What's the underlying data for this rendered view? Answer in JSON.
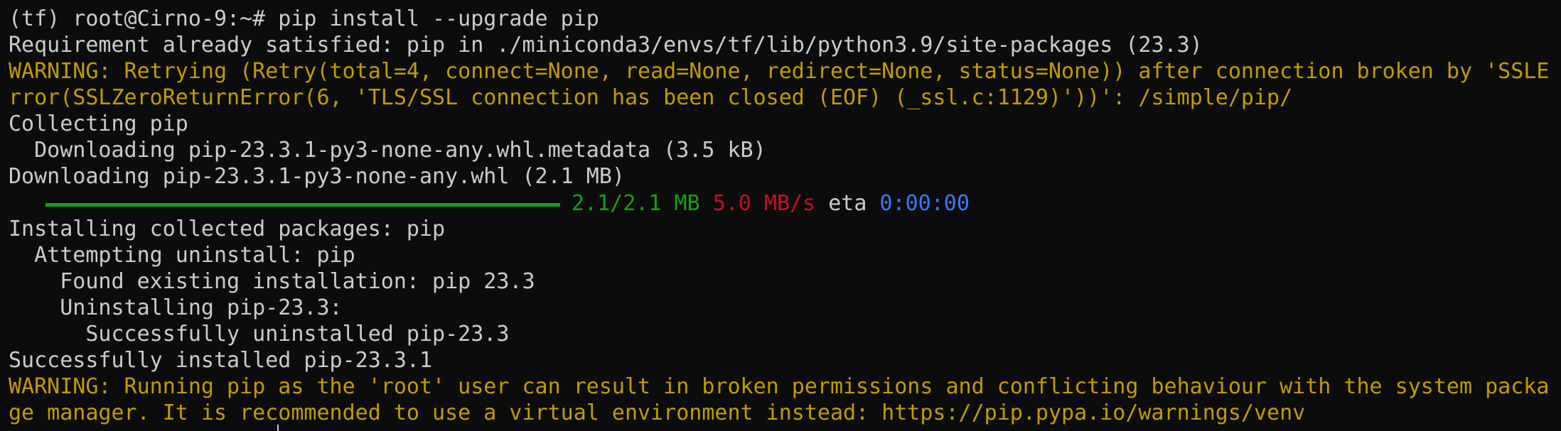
{
  "colors": {
    "background": "#0c0c0c",
    "text": "#cccccc",
    "warning": "#c19c00",
    "green": "#13a10e",
    "red": "#c50f1f",
    "blue": "#3b78ff"
  },
  "terminal": {
    "prompt": "(tf) root@Cirno-9:~# pip install --upgrade pip",
    "lines": {
      "req": "Requirement already satisfied: pip in ./miniconda3/envs/tf/lib/python3.9/site-packages (23.3)",
      "warn1a": "WARNING: Retrying (Retry(total=4, connect=None, read=None, redirect=None, status=None)) after connection broken by 'SSLE",
      "warn1b": "rror(SSLZeroReturnError(6, 'TLS/SSL connection has been closed (EOF) (_ssl.c:1129)'))': /simple/pip/",
      "collecting": "Collecting pip",
      "downloading_meta": "  Downloading pip-23.3.1-py3-none-any.whl.metadata (3.5 kB)",
      "downloading_whl": "Downloading pip-23.3.1-py3-none-any.whl (2.1 MB)",
      "installing": "Installing collected packages: pip",
      "attempting": "  Attempting uninstall: pip",
      "found": "    Found existing installation: pip 23.3",
      "uninstalling": "    Uninstalling pip-23.3:",
      "uninstalled": "      Successfully uninstalled pip-23.3",
      "installed": "Successfully installed pip-23.3.1",
      "warn2a": "WARNING: Running pip as the 'root' user can result in broken permissions and conflicting behaviour with the system packa",
      "warn2b": "ge manager. It is recommended to use a virtual environment instead: https://pip.pypa.io/warnings/venv"
    },
    "progress": {
      "fraction": 1.0,
      "size": "2.1/2.1 MB",
      "speed": "5.0 MB/s",
      "eta_label": "eta",
      "eta": "0:00:00"
    }
  }
}
